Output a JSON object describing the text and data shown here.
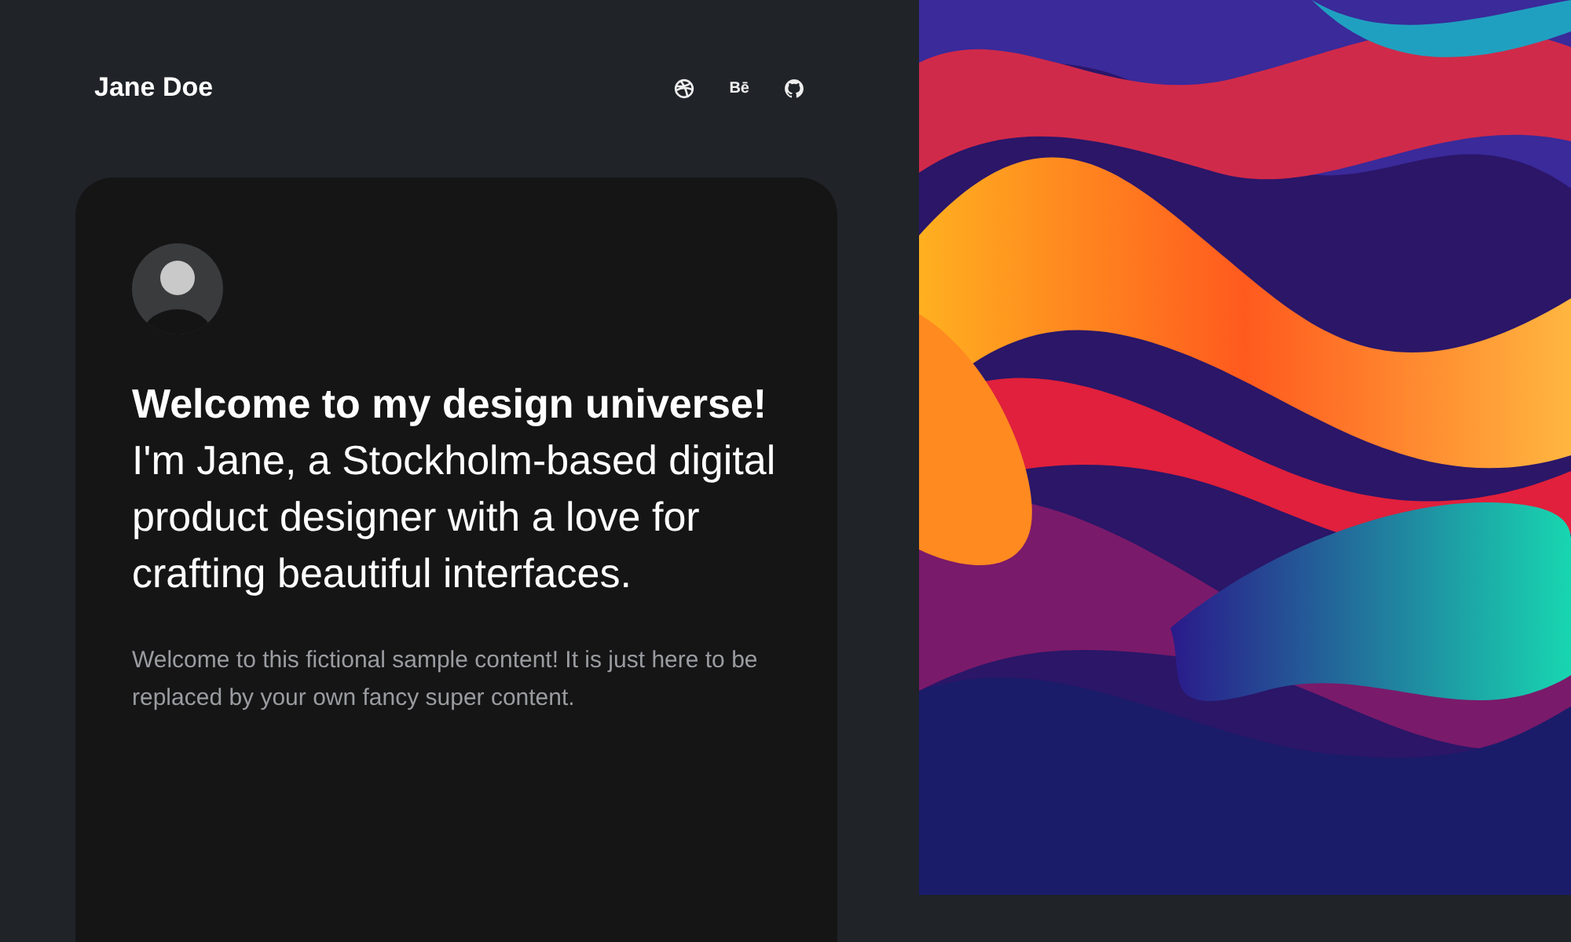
{
  "header": {
    "name": "Jane Doe",
    "social_links": [
      {
        "kind": "dribbble"
      },
      {
        "kind": "behance",
        "label": "Bē"
      },
      {
        "kind": "github"
      }
    ]
  },
  "intro_card": {
    "headline": "**Welcome to my design universe!** I'm Jane, a Stockholm-based digital product designer with a love for crafting beautiful interfaces.",
    "body": "Welcome to this fictional sample content! It is just here to be replaced by your own fancy super content."
  }
}
